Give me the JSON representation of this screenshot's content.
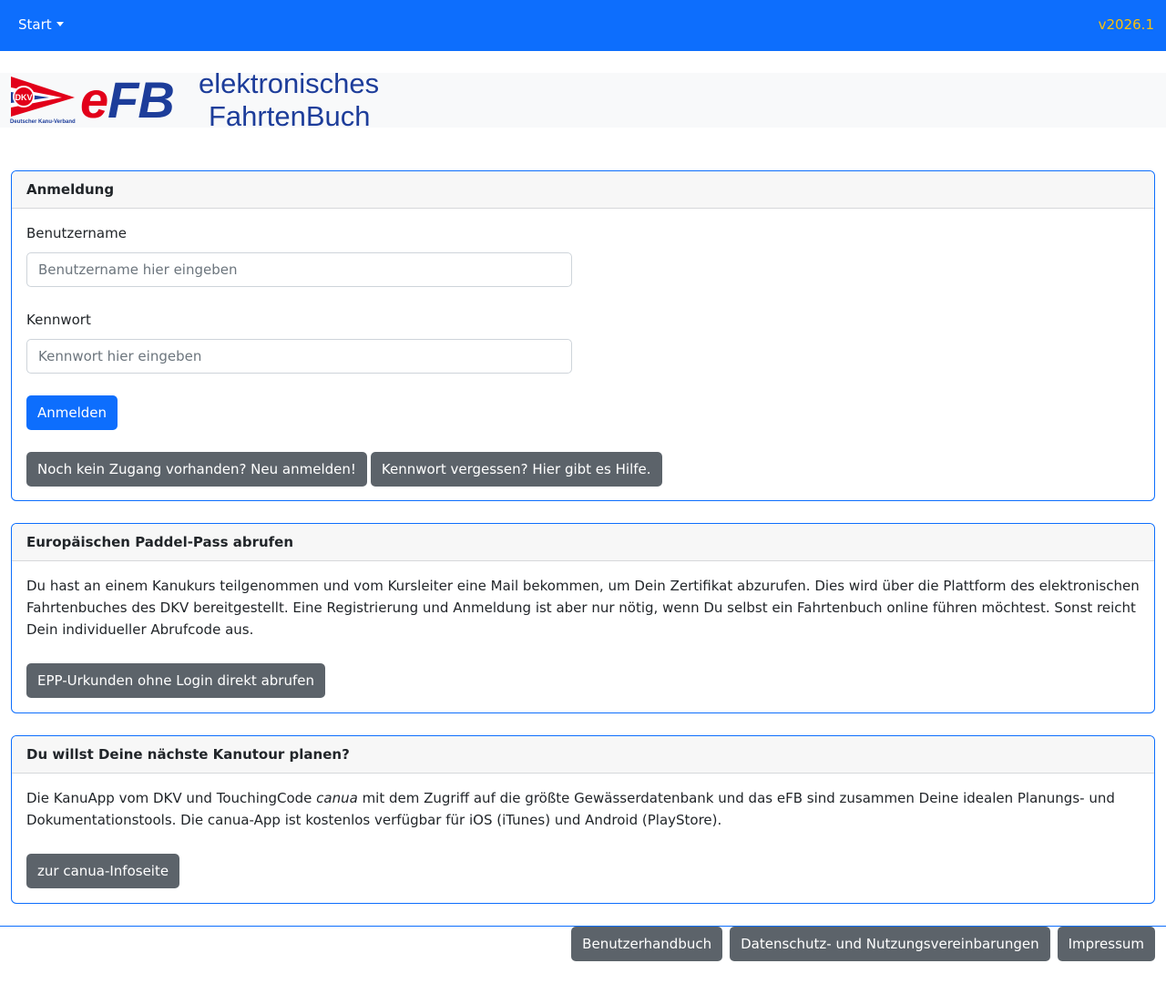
{
  "navbar": {
    "start_label": "Start",
    "version": "v2026.1"
  },
  "logo": {
    "org_caption": "Deutscher Kanu-Verband",
    "flag_text": "DKV",
    "word_e": "e",
    "word_fb": "FB",
    "subtitle_line1": "elektronisches",
    "subtitle_line2": "FahrtenBuch"
  },
  "login": {
    "title": "Anmeldung",
    "username_label": "Benutzername",
    "username_placeholder": "Benutzername hier eingeben",
    "password_label": "Kennwort",
    "password_placeholder": "Kennwort hier eingeben",
    "submit_label": "Anmelden",
    "register_label": "Noch kein Zugang vorhanden? Neu anmelden!",
    "forgot_label": "Kennwort vergessen? Hier gibt es Hilfe."
  },
  "epp": {
    "title": "Europäischen Paddel-Pass abrufen",
    "text": "Du hast an einem Kanukurs teilgenommen und vom Kursleiter eine Mail bekommen, um Dein Zertifikat abzurufen. Dies wird über die Plattform des elektronischen Fahrtenbuches des DKV bereitgestellt. Eine Registrierung und Anmeldung ist aber nur nötig, wenn Du selbst ein Fahrtenbuch online führen möchtest. Sonst reicht Dein individueller Abrufcode aus.",
    "button_label": "EPP-Urkunden ohne Login direkt abrufen"
  },
  "canua": {
    "title": "Du willst Deine nächste Kanutour planen?",
    "text_before": "Die KanuApp vom DKV und TouchingCode ",
    "text_em": "canua",
    "text_after": " mit dem Zugriff auf die größte Gewässerdatenbank und das eFB sind zusammen Deine idealen Planungs- und Dokumentationstools. Die canua-App ist kostenlos verfügbar für iOS (iTunes) und Android (PlayStore).",
    "button_label": "zur canua-Infoseite"
  },
  "footer": {
    "manual_label": "Benutzerhandbuch",
    "privacy_label": "Datenschutz- und Nutzungsvereinbarungen",
    "imprint_label": "Impressum"
  },
  "colors": {
    "primary": "#0d6efd",
    "secondary": "#5c636a",
    "version": "#ffc107",
    "logo_red": "#e2001a",
    "logo_blue": "#1d3d9a"
  },
  "icons": {
    "nav_caret": "caret-down-icon",
    "logo": "dkv-pennant-logo"
  }
}
